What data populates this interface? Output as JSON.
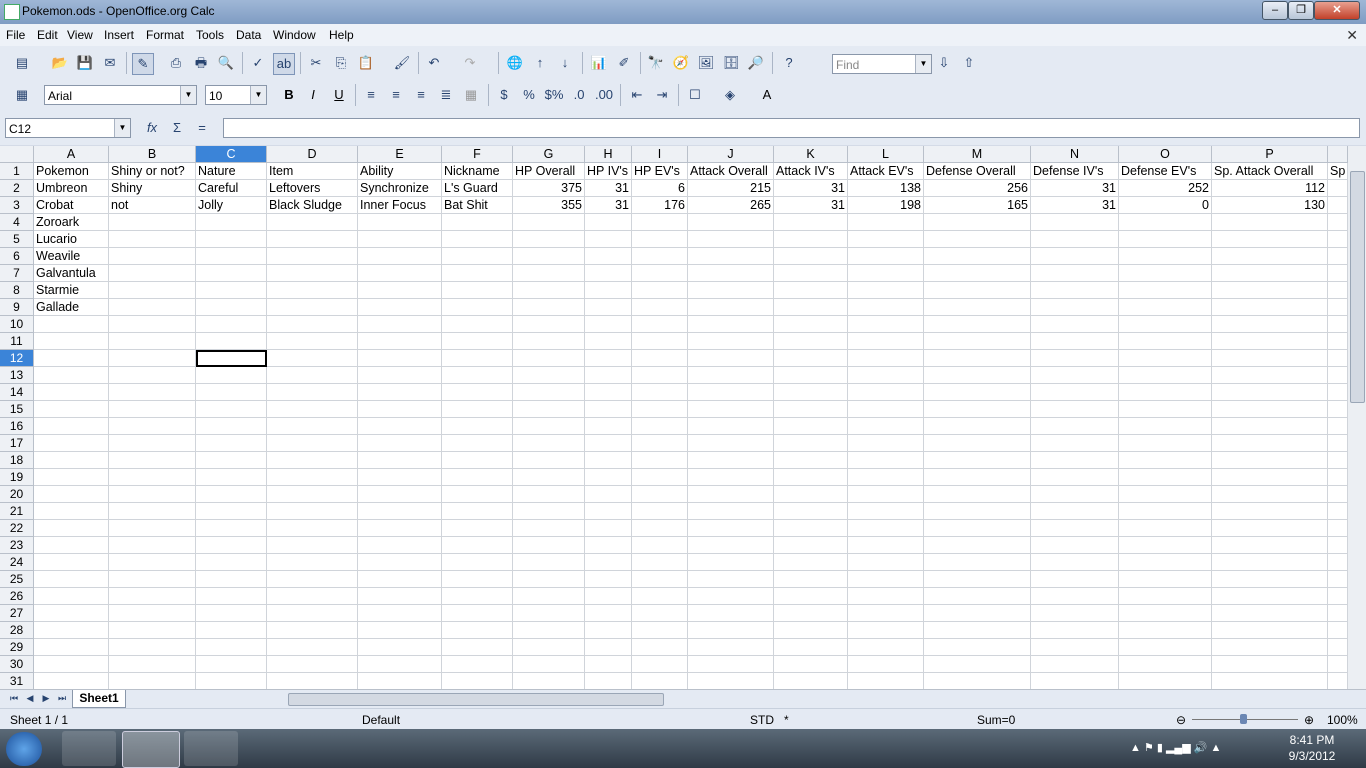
{
  "window": {
    "title": "Pokemon.ods - OpenOffice.org Calc"
  },
  "menu": [
    "File",
    "Edit",
    "View",
    "Insert",
    "Format",
    "Tools",
    "Data",
    "Window",
    "Help"
  ],
  "toolbar": {
    "find_placeholder": "Find",
    "font_name": "Arial",
    "font_size": "10"
  },
  "formula": {
    "name_box": "C12",
    "content": ""
  },
  "columns": [
    "A",
    "B",
    "C",
    "D",
    "E",
    "F",
    "G",
    "H",
    "I",
    "J",
    "K",
    "L",
    "M",
    "N",
    "O",
    "P"
  ],
  "rows": {
    "1": [
      "Pokemon",
      "Shiny or not?",
      "Nature",
      "Item",
      "Ability",
      "Nickname",
      "HP Overall",
      "HP IV's",
      "HP EV's",
      "Attack Overall",
      "Attack IV's",
      "Attack EV's",
      "Defense Overall",
      "Defense IV's",
      "Defense EV's",
      "Sp. Attack Overall",
      "Sp"
    ],
    "2": [
      "Umbreon",
      "Shiny",
      "Careful",
      "Leftovers",
      "Synchronize",
      "L's Guard",
      "375",
      "31",
      "6",
      "215",
      "31",
      "138",
      "256",
      "31",
      "252",
      "112"
    ],
    "3": [
      "Crobat",
      "not",
      "Jolly",
      "Black Sludge",
      "Inner Focus",
      "Bat Shit",
      "355",
      "31",
      "176",
      "265",
      "31",
      "198",
      "165",
      "31",
      "0",
      "130"
    ],
    "4": [
      "Zoroark"
    ],
    "5": [
      "Lucario"
    ],
    "6": [
      "Weavile"
    ],
    "7": [
      "Galvantula"
    ],
    "8": [
      "Starmie"
    ],
    "9": [
      "Gallade"
    ]
  },
  "selected_cell": "C12",
  "sheet_tab": "Sheet1",
  "status": {
    "sheet": "Sheet 1 / 1",
    "style": "Default",
    "mode": "STD",
    "modified": "*",
    "sum": "Sum=0",
    "zoom": "100%"
  },
  "clock": {
    "time": "8:41 PM",
    "date": "9/3/2012"
  }
}
